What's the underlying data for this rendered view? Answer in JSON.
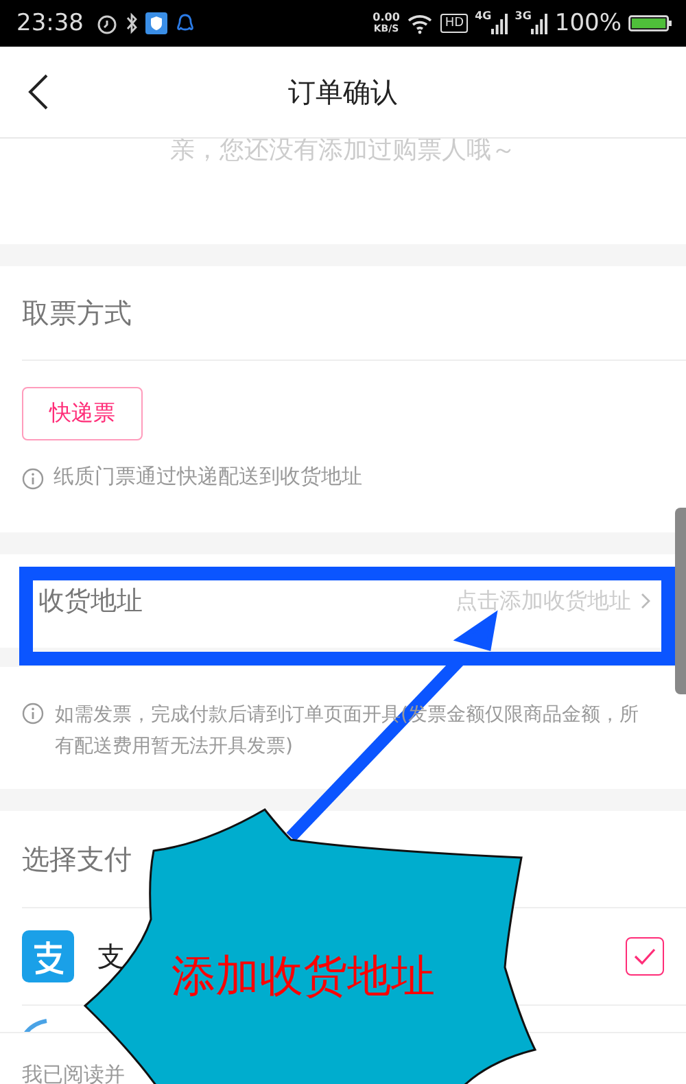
{
  "status_bar": {
    "time": "23:38",
    "speed": "0.00",
    "speed_unit": "KB/S",
    "hd": "HD",
    "networks": [
      "4G",
      "3G"
    ],
    "battery": "100%"
  },
  "nav": {
    "title": "订单确认"
  },
  "buyer_empty_text": "亲，您还没有添加过购票人哦～",
  "ticket_method": {
    "title": "取票方式",
    "options": [
      {
        "label": "快递票",
        "selected": true
      }
    ],
    "note": "纸质门票通过快递配送到收货地址"
  },
  "address": {
    "label": "收货地址",
    "hint": "点击添加收货地址"
  },
  "invoice_note": "如需发票，完成付款后请到订单页面开具(发票金额仅限商品金额，所有配送费用暂无法开具发票)",
  "payment": {
    "title": "选择支付",
    "methods": [
      {
        "name": "支",
        "selected": true
      }
    ]
  },
  "agreement_text": "我已阅读并",
  "annotation": {
    "text": "添加收货地址"
  }
}
